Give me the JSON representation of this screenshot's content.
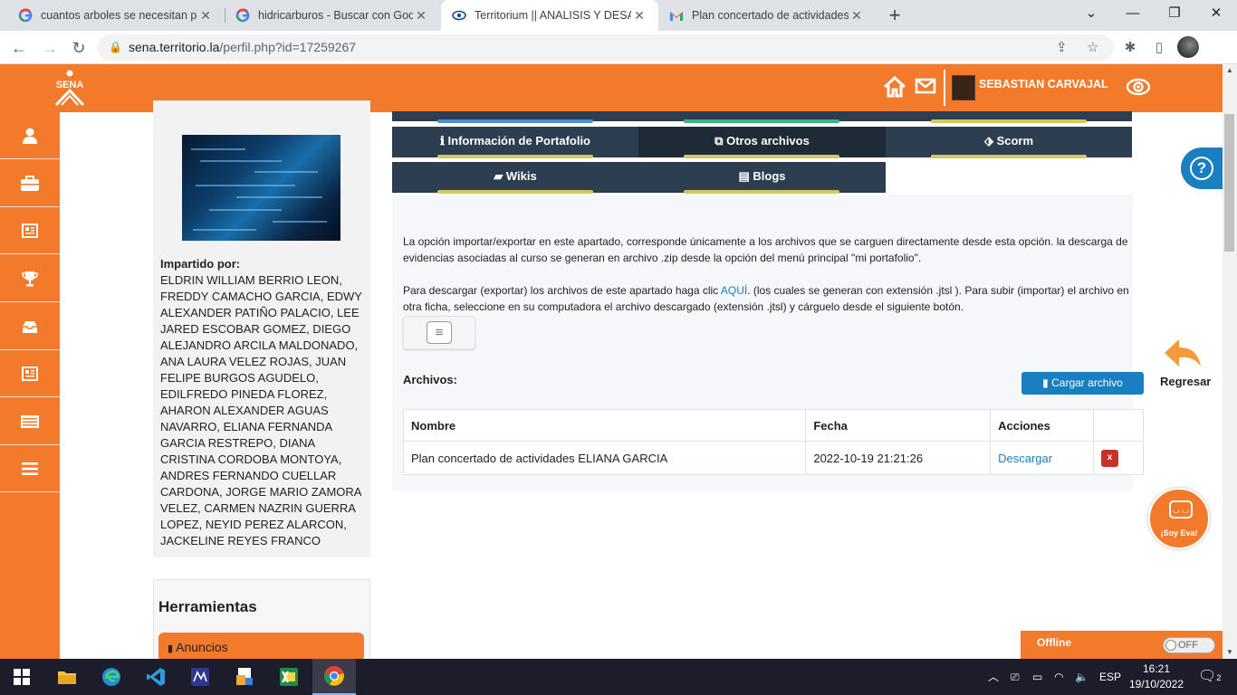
{
  "browser": {
    "tabs": [
      {
        "title": "cuantos arboles se necesitan para",
        "favicon": "google-icon",
        "active": false
      },
      {
        "title": "hidricarburos - Buscar con Googl",
        "favicon": "google-icon",
        "active": false
      },
      {
        "title": "Territorium || ANALISIS Y DESARR",
        "favicon": "territorium-eye-icon",
        "active": true
      },
      {
        "title": "Plan concertado de actividades -",
        "favicon": "gmail-icon",
        "active": false
      }
    ],
    "address": {
      "domain": "sena.territorio.la",
      "path": "/perfil.php?id=17259267"
    }
  },
  "header": {
    "logo_text": "SENA",
    "user_name": "SEBASTIAN CARVAJAL"
  },
  "left_nav": [
    "user-icon",
    "briefcase-icon",
    "newspaper-icon",
    "trophy-icon",
    "inbox-icon",
    "notebook-icon",
    "card-icon",
    "menu-icon"
  ],
  "sidebar": {
    "impartido_label": "Impartido por:",
    "impartido_list": "ELDRIN WILLIAM BERRIO LEON, FREDDY CAMACHO GARCIA, EDWY ALEXANDER PATIÑO PALACIO, LEE JARED ESCOBAR GOMEZ, DIEGO ALEJANDRO ARCILA MALDONADO, ANA LAURA VELEZ ROJAS, JUAN FELIPE BURGOS AGUDELO, EDILFREDO PINEDA FLOREZ, AHARON ALEXANDER AGUAS NAVARRO, ELIANA FERNANDA GARCIA RESTREPO, DIANA CRISTINA CORDOBA MONTOYA, ANDRES FERNANDO CUELLAR CARDONA, JORGE MARIO ZAMORA VELEZ, CARMEN NAZRIN GUERRA LOPEZ, NEYID PEREZ ALARCON, JACKELINE REYES FRANCO",
    "tools_title": "Herramientas",
    "tools_button": "Anuncios"
  },
  "tabs": {
    "info": "Información de Portafolio",
    "otros": "Otros archivos",
    "scorm": "Scorm",
    "wikis": "Wikis",
    "blogs": "Blogs"
  },
  "content": {
    "para1": "La opción importar/exportar en este apartado, corresponde únicamente a los archivos que se carguen directamente desde esta opción. la descarga de evidencias asociadas al curso se generan en archivo .zip desde la opción del menú principal \"mi portafolio\".",
    "para2_a": "Para descargar (exportar) los archivos de este apartado haga clic ",
    "para2_link": "AQUÍ",
    "para2_b": ". (los cuales se generan con extensión .jtsl ). Para subir (importar) el archivo en otra ficha, seleccione en su computadora el archivo descargado (extensión .jtsl) y cárguelo desde el siguiente botón.",
    "archivos_label": "Archivos:",
    "cargar_button": "Cargar archivo",
    "table": {
      "headers": [
        "Nombre",
        "Fecha",
        "Acciones",
        ""
      ],
      "rows": [
        {
          "nombre": "Plan concertado de actividades ELIANA GARCIA",
          "fecha": "2022-10-19 21:21:26",
          "accion": "Descargar",
          "delete": "x"
        }
      ]
    }
  },
  "widgets": {
    "help": "?",
    "back_label": "Regresar",
    "eva_label": "¡Soy Eva!",
    "offline_label": "Offline",
    "toggle_label": "OFF"
  },
  "taskbar": {
    "lang": "ESP",
    "time": "16:21",
    "date": "19/10/2022",
    "notifications": "2"
  }
}
